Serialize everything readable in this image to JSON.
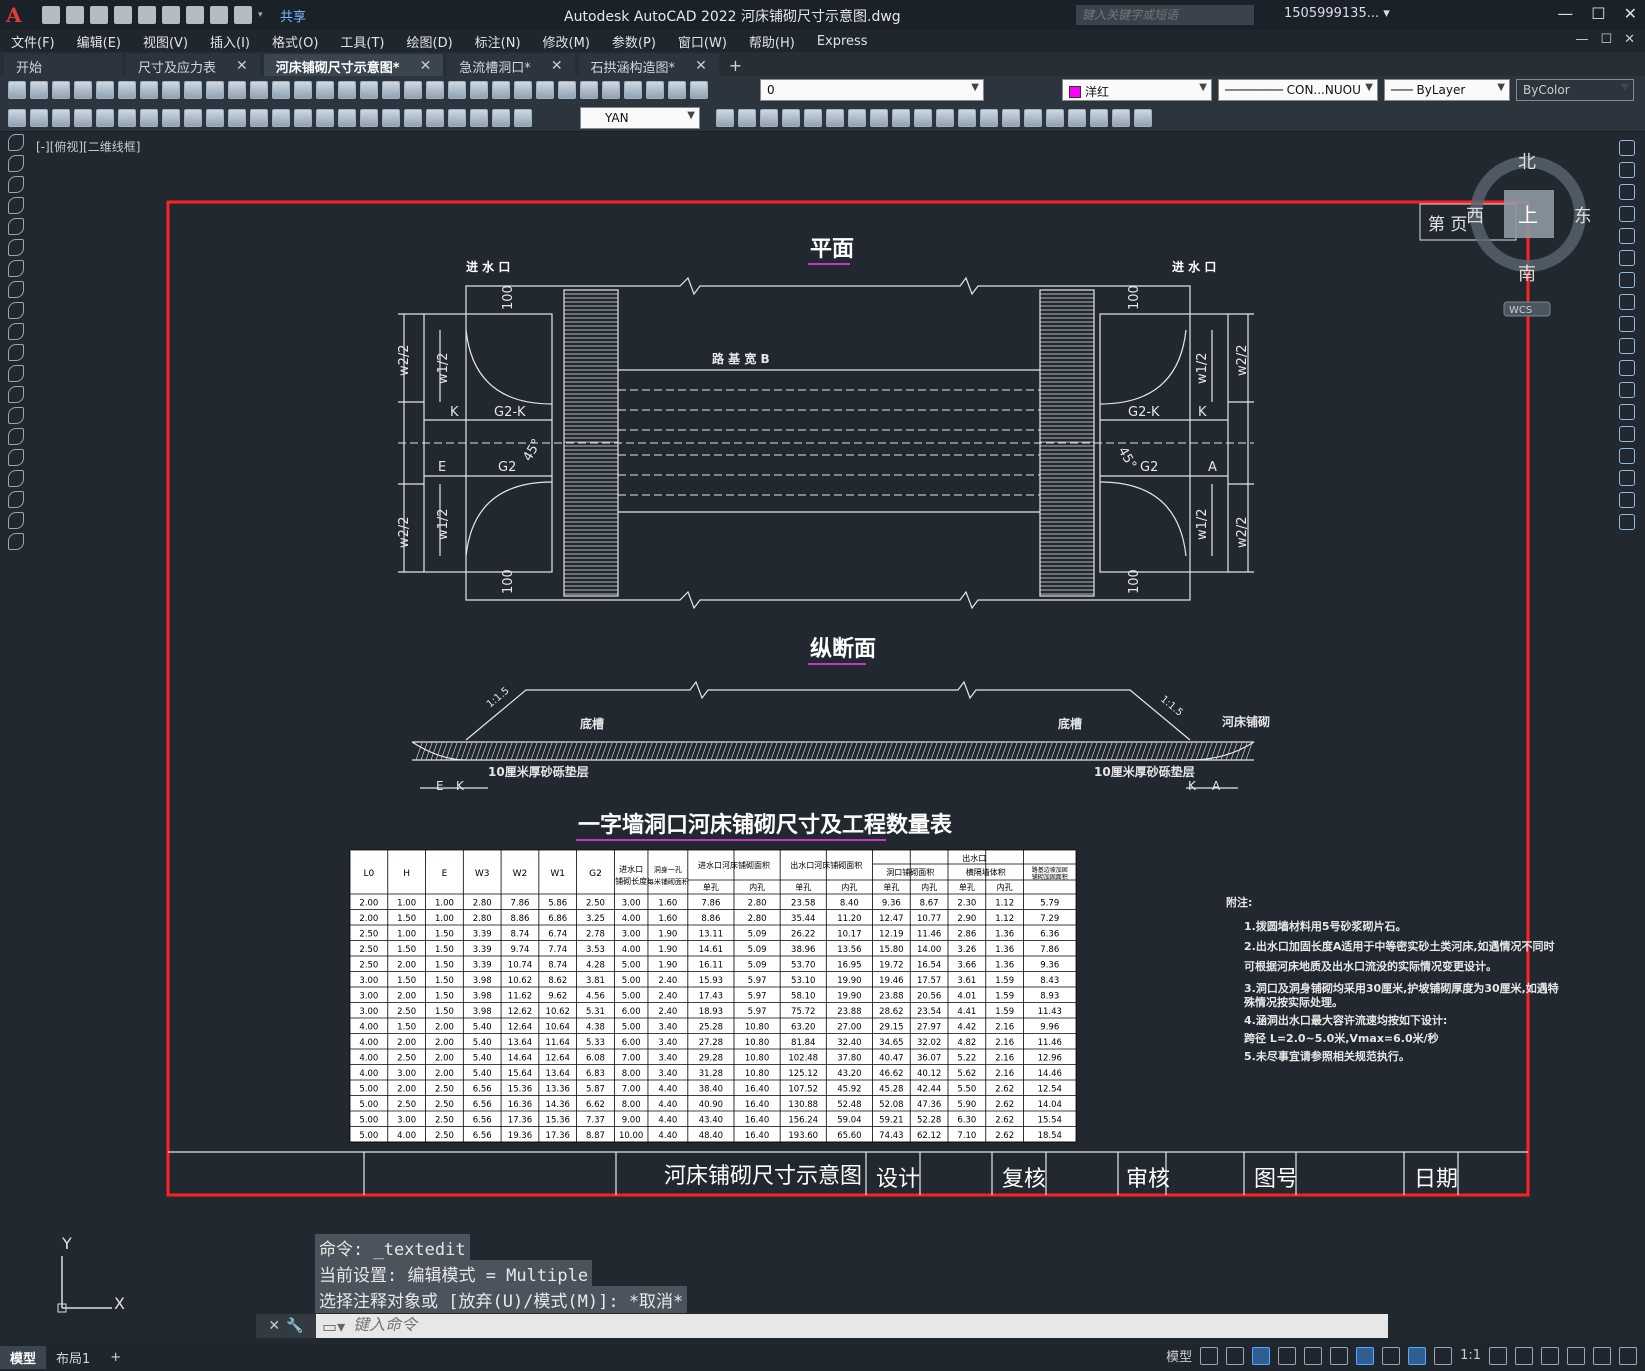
{
  "window": {
    "logo": "A",
    "title": "Autodesk AutoCAD 2022    河床铺砌尺寸示意图.dwg",
    "share": "共享",
    "search_placeholder": "键入关键字或短语",
    "user": "1505999135... ▾",
    "controls": [
      "—",
      "☐",
      "✕"
    ]
  },
  "menu": [
    "文件(F)",
    "编辑(E)",
    "视图(V)",
    "插入(I)",
    "格式(O)",
    "工具(T)",
    "绘图(D)",
    "标注(N)",
    "修改(M)",
    "参数(P)",
    "窗口(W)",
    "帮助(H)",
    "Express"
  ],
  "tabs": [
    {
      "label": "开始",
      "active": false,
      "close": false
    },
    {
      "label": "尺寸及应力表",
      "active": false,
      "close": true
    },
    {
      "label": "河床铺砌尺寸示意图*",
      "active": true,
      "close": true
    },
    {
      "label": "急流槽洞口*",
      "active": false,
      "close": true
    },
    {
      "label": "石拱涵构造图*",
      "active": false,
      "close": true
    }
  ],
  "toolbar": {
    "layer_value": "0",
    "color_value": "洋红",
    "color_hex": "#ff00ff",
    "linetype_value": "CON...NUOU",
    "lineweight_value": "ByLayer",
    "plotstyle_value": "ByColor",
    "textstyle_value": "YAN"
  },
  "viewport_label": "[-][俯视][二维线框]",
  "viewcube": {
    "north": "北",
    "south": "南",
    "east": "东",
    "west": "西",
    "top": "上",
    "wcs": "WCS"
  },
  "drawing": {
    "page_no": "第   页",
    "plan_title": "平面",
    "section_title": "纵断面",
    "table_title": "一字墙洞口河床铺砌尺寸及工程数量表",
    "inlet_left": "进 水 口",
    "inlet_right": "进 水 口",
    "road_width": "路 基 宽 B",
    "dims": {
      "w22": "w2/2",
      "w12": "w1/2",
      "g2k": "G2-K",
      "g2": "G2",
      "k": "K",
      "e": "E",
      "a": "A",
      "d100": "100",
      "angle": "45°"
    },
    "section_labels": {
      "slope": "1:1.5",
      "trench": "底槽",
      "gravel": "10厘米厚砂砾垫层",
      "paving": "河床铺砌"
    },
    "table_head": [
      "L0",
      "H",
      "E",
      "W3",
      "W2",
      "W1",
      "G2",
      "进水口铺砌长度",
      "洞身一孔每米铺砌面积",
      "进水口河床铺砌面积",
      "出水口河床铺砌面积",
      "出水口"
    ],
    "table_sub_outlet": [
      "洞口铺砌面积",
      "横隔墙体积",
      "路基边坡加固铺砌加固面积"
    ],
    "table_sub_cols": [
      "单孔",
      "内孔",
      "单孔",
      "内孔",
      "单孔",
      "内孔",
      "单孔",
      "内孔"
    ],
    "table_rows": [
      [
        "2.00",
        "1.00",
        "1.00",
        "2.80",
        "7.86",
        "5.86",
        "2.50",
        "3.00",
        "1.60",
        "7.86",
        "2.80",
        "23.58",
        "8.40",
        "9.36",
        "8.67",
        "2.30",
        "1.12",
        "5.79"
      ],
      [
        "2.00",
        "1.50",
        "1.00",
        "2.80",
        "8.86",
        "6.86",
        "3.25",
        "4.00",
        "1.60",
        "8.86",
        "2.80",
        "35.44",
        "11.20",
        "12.47",
        "10.77",
        "2.90",
        "1.12",
        "7.29"
      ],
      [
        "2.50",
        "1.00",
        "1.50",
        "3.39",
        "8.74",
        "6.74",
        "2.78",
        "3.00",
        "1.90",
        "13.11",
        "5.09",
        "26.22",
        "10.17",
        "12.19",
        "11.46",
        "2.86",
        "1.36",
        "6.36"
      ],
      [
        "2.50",
        "1.50",
        "1.50",
        "3.39",
        "9.74",
        "7.74",
        "3.53",
        "4.00",
        "1.90",
        "14.61",
        "5.09",
        "38.96",
        "13.56",
        "15.80",
        "14.00",
        "3.26",
        "1.36",
        "7.86"
      ],
      [
        "2.50",
        "2.00",
        "1.50",
        "3.39",
        "10.74",
        "8.74",
        "4.28",
        "5.00",
        "1.90",
        "16.11",
        "5.09",
        "53.70",
        "16.95",
        "19.72",
        "16.54",
        "3.66",
        "1.36",
        "9.36"
      ],
      [
        "3.00",
        "1.50",
        "1.50",
        "3.98",
        "10.62",
        "8.62",
        "3.81",
        "5.00",
        "2.40",
        "15.93",
        "5.97",
        "53.10",
        "19.90",
        "19.46",
        "17.57",
        "3.61",
        "1.59",
        "8.43"
      ],
      [
        "3.00",
        "2.00",
        "1.50",
        "3.98",
        "11.62",
        "9.62",
        "4.56",
        "5.00",
        "2.40",
        "17.43",
        "5.97",
        "58.10",
        "19.90",
        "23.88",
        "20.56",
        "4.01",
        "1.59",
        "8.93"
      ],
      [
        "3.00",
        "2.50",
        "1.50",
        "3.98",
        "12.62",
        "10.62",
        "5.31",
        "6.00",
        "2.40",
        "18.93",
        "5.97",
        "75.72",
        "23.88",
        "28.62",
        "23.54",
        "4.41",
        "1.59",
        "11.43"
      ],
      [
        "4.00",
        "1.50",
        "2.00",
        "5.40",
        "12.64",
        "10.64",
        "4.38",
        "5.00",
        "3.40",
        "25.28",
        "10.80",
        "63.20",
        "27.00",
        "29.15",
        "27.97",
        "4.42",
        "2.16",
        "9.96"
      ],
      [
        "4.00",
        "2.00",
        "2.00",
        "5.40",
        "13.64",
        "11.64",
        "5.33",
        "6.00",
        "3.40",
        "27.28",
        "10.80",
        "81.84",
        "32.40",
        "34.65",
        "32.02",
        "4.82",
        "2.16",
        "11.46"
      ],
      [
        "4.00",
        "2.50",
        "2.00",
        "5.40",
        "14.64",
        "12.64",
        "6.08",
        "7.00",
        "3.40",
        "29.28",
        "10.80",
        "102.48",
        "37.80",
        "40.47",
        "36.07",
        "5.22",
        "2.16",
        "12.96"
      ],
      [
        "4.00",
        "3.00",
        "2.00",
        "5.40",
        "15.64",
        "13.64",
        "6.83",
        "8.00",
        "3.40",
        "31.28",
        "10.80",
        "125.12",
        "43.20",
        "46.62",
        "40.12",
        "5.62",
        "2.16",
        "14.46"
      ],
      [
        "5.00",
        "2.00",
        "2.50",
        "6.56",
        "15.36",
        "13.36",
        "5.87",
        "7.00",
        "4.40",
        "38.40",
        "16.40",
        "107.52",
        "45.92",
        "45.28",
        "42.44",
        "5.50",
        "2.62",
        "12.54"
      ],
      [
        "5.00",
        "2.50",
        "2.50",
        "6.56",
        "16.36",
        "14.36",
        "6.62",
        "8.00",
        "4.40",
        "40.90",
        "16.40",
        "130.88",
        "52.48",
        "52.08",
        "47.36",
        "5.90",
        "2.62",
        "14.04"
      ],
      [
        "5.00",
        "3.00",
        "2.50",
        "6.56",
        "17.36",
        "15.36",
        "7.37",
        "9.00",
        "4.40",
        "43.40",
        "16.40",
        "156.24",
        "59.04",
        "59.21",
        "52.28",
        "6.30",
        "2.62",
        "15.54"
      ],
      [
        "5.00",
        "4.00",
        "2.50",
        "6.56",
        "19.36",
        "17.36",
        "8.87",
        "10.00",
        "4.40",
        "48.40",
        "16.40",
        "193.60",
        "65.60",
        "74.43",
        "62.12",
        "7.10",
        "2.62",
        "18.54"
      ]
    ],
    "notes_title": "附注:",
    "notes": [
      "1.拨圆墙材料用5号砂浆砌片石。",
      "2.出水口加固长度A适用于中等密实砂土类河床,如遇情况不同时",
      "  可根据河床地质及出水口流没的实际情况变更设计。",
      "3.洞口及洞身铺砌均采用30厘米,护坡铺砌厚度为30厘米,如遇特",
      "  殊情况按实际处理。",
      "4.涵洞出水口最大容许流速均按如下设计:",
      "  跨径 L=2.0~5.0米,Vmax=6.0米/秒",
      "5.未尽事宜请参照相关规范执行。"
    ],
    "titleblock": {
      "name": "河床铺砌尺寸示意图",
      "design": "设计",
      "check": "复核",
      "review": "审核",
      "drawing_no": "图号",
      "date": "日期"
    }
  },
  "command": {
    "history": [
      "命令: _textedit",
      "当前设置: 编辑模式 = Multiple",
      "选择注释对象或 [放弃(U)/模式(M)]: *取消*"
    ],
    "placeholder": "键入命令"
  },
  "ucs": {
    "y": "Y",
    "x": "X"
  },
  "status": {
    "tabs": [
      "模型",
      "布局1",
      "+"
    ],
    "model_label": "模型",
    "scale": "1:1"
  }
}
